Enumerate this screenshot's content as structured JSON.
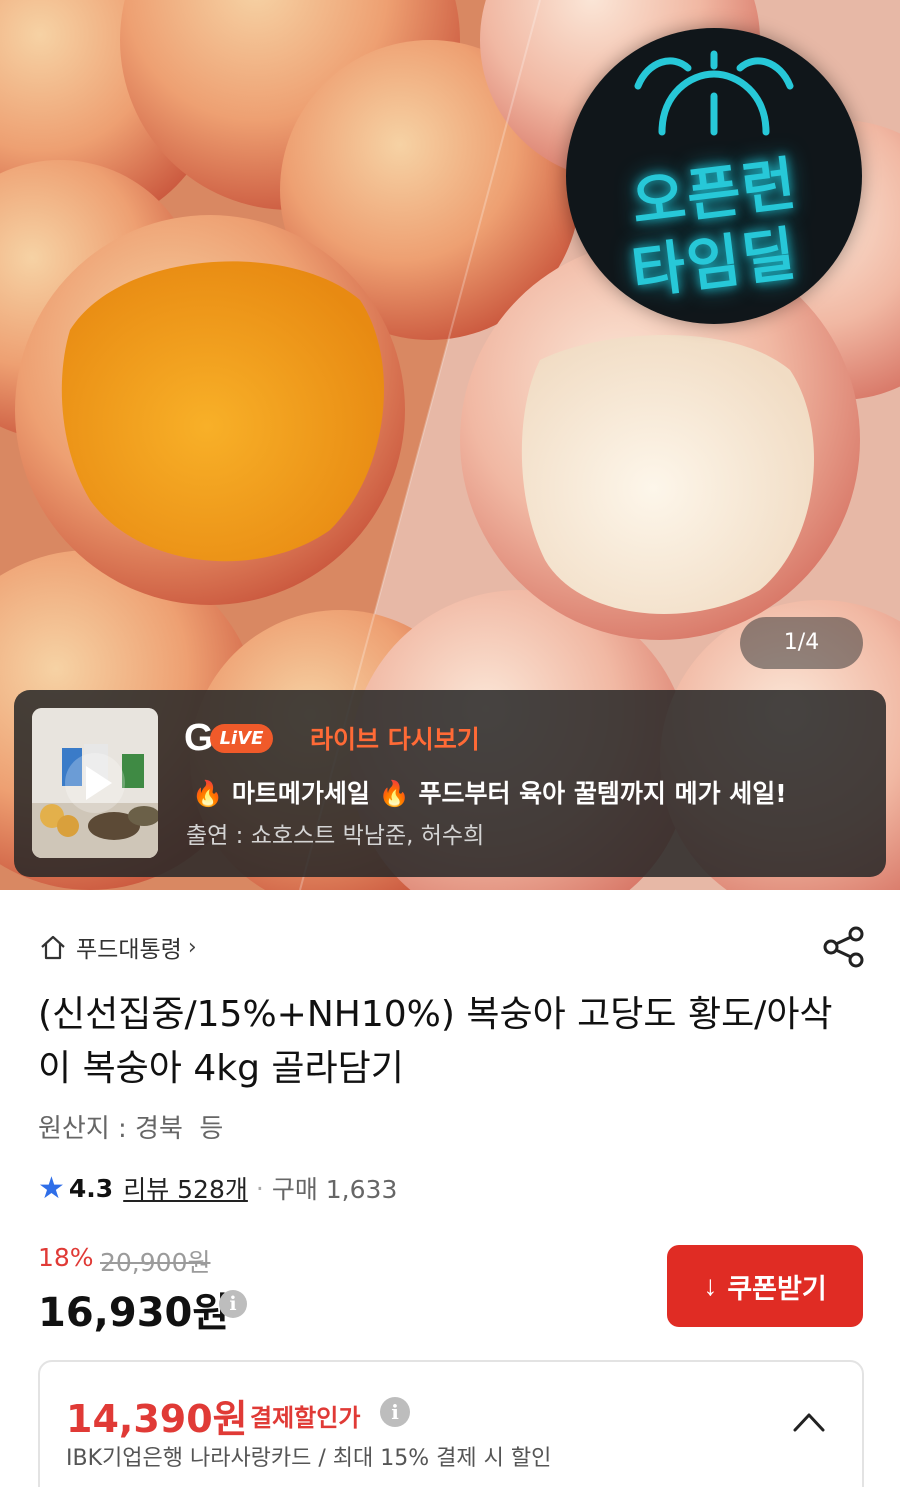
{
  "hero": {
    "badge_line1": "오픈런",
    "badge_line2": "타임딜",
    "pager": "1/4"
  },
  "live": {
    "logo_g": "G",
    "logo_pill": "LiVE",
    "title": "라이브 다시보기",
    "headline_part1": "마트메가세일",
    "headline_part2": "푸드부터 육아 꿀템까지 메가 세일!",
    "fire_icon": "🔥",
    "cast": "출연 : 쇼호스트 박남준, 허수희"
  },
  "breadcrumb": {
    "label": "푸드대통령",
    "chevron": "›"
  },
  "product": {
    "title": "(신선집중/15%+NH10%) 복숭아 고당도 황도/아삭이 복숭아 4kg 골라담기",
    "origin": "원산지 : 경북  등",
    "rating": "4.3",
    "review": "리뷰 528개",
    "dot": "·",
    "purchases": "구매 1,633"
  },
  "price": {
    "discount": "18%",
    "original": "20,900원",
    "sale": "16,930원",
    "info": "i"
  },
  "coupon": {
    "label": "쿠폰받기",
    "icon": "↓"
  },
  "card_discount": {
    "price": "14,390원",
    "label": "결제할인가",
    "info": "i",
    "description": "IBK기업은행 나라사랑카드 / 최대 15% 결제 시 할인"
  },
  "colors": {
    "accent": "#e02c24",
    "badge_text": "#27c8d8",
    "rating_star": "#2f6ee8",
    "live_accent": "#ff6a36"
  }
}
